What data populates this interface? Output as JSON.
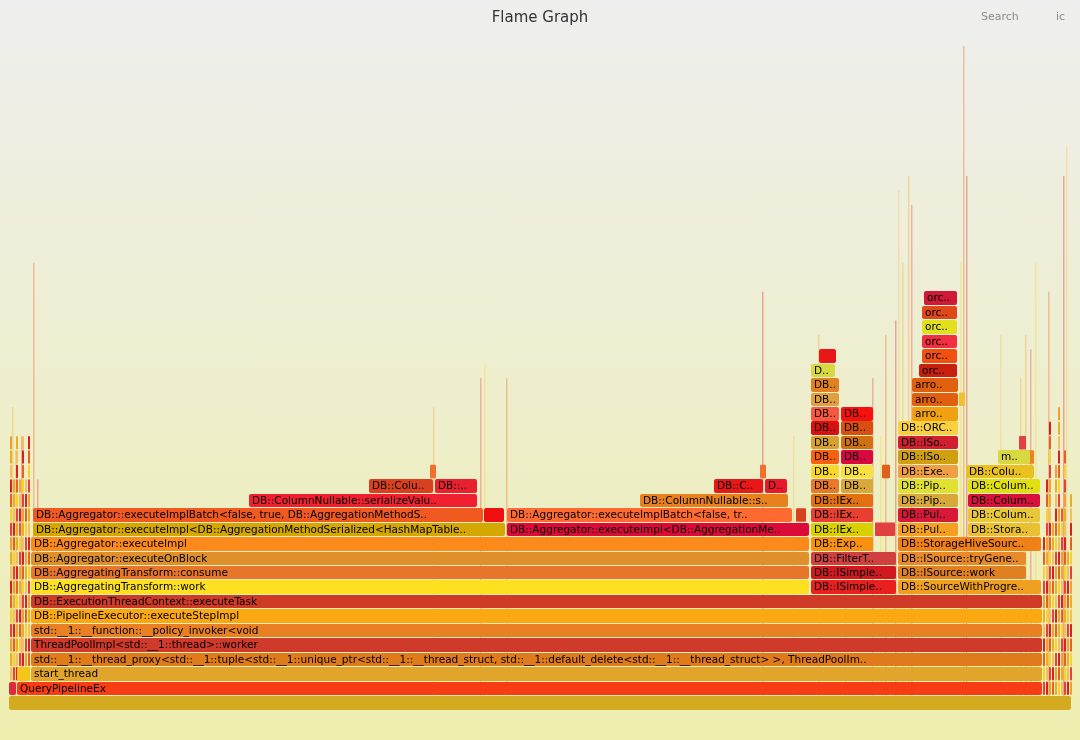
{
  "title": "Flame Graph",
  "search": {
    "label": "Search"
  },
  "toolbar_button": {
    "label": "ic"
  },
  "frames": [
    {
      "label": "orc..",
      "color": "#d01838"
    },
    {
      "label": "orc..",
      "color": "#e04818"
    },
    {
      "label": "orc..",
      "color": "#e0e020"
    },
    {
      "label": "orc..",
      "color": "#f03040"
    },
    {
      "color": "#e81818"
    },
    {
      "label": "orc..",
      "color": "#f05010"
    },
    {
      "label": "D..",
      "color": "#d8d840"
    },
    {
      "label": "orc..",
      "color": "#c82010"
    },
    {
      "label": "DB..",
      "color": "#e08020"
    },
    {
      "label": "arro..",
      "color": "#e06010"
    },
    {
      "label": "DB..",
      "color": "#e0a040"
    },
    {
      "label": "arro..",
      "color": "#e06010"
    },
    {
      "label": "DB..",
      "color": "#f85840"
    },
    {
      "label": "DB..",
      "color": "#f81010"
    },
    {
      "label": "arro..",
      "color": "#f0a010"
    },
    {
      "label": "DB..",
      "color": "#d81010"
    },
    {
      "label": "DB..",
      "color": "#d85010"
    },
    {
      "label": "DB::ORC..",
      "color": "#f8d040"
    },
    {
      "label": "DB..",
      "color": "#d8a030"
    },
    {
      "label": "DB..",
      "color": "#d07010"
    },
    {
      "label": "DB::ISo..",
      "color": "#d02030"
    },
    {
      "label": "DB..",
      "color": "#f86010"
    },
    {
      "label": "DB..",
      "color": "#d80840"
    },
    {
      "label": "DB::ISo..",
      "color": "#d0a010"
    },
    {
      "label": "m..",
      "color": "#d8d840"
    },
    {
      "label": "DB..",
      "color": "#f8d828"
    },
    {
      "label": "DB..",
      "color": "#f8e040"
    },
    {
      "label": "DB::Exe..",
      "color": "#f0a040"
    },
    {
      "label": "DB::Colu..",
      "color": "#e8c020"
    },
    {
      "label": "DB::Colu..",
      "color": "#d84020"
    },
    {
      "label": "DB::..",
      "color": "#e82030"
    },
    {
      "label": "DB::C..",
      "color": "#e81818"
    },
    {
      "label": "D..",
      "color": "#e81828"
    },
    {
      "label": "DB..",
      "color": "#e8782a"
    },
    {
      "label": "DB..",
      "color": "#d8a838"
    },
    {
      "label": "DB::Pip..",
      "color": "#e0e030"
    },
    {
      "label": "DB::Colum..",
      "color": "#e0e010"
    },
    {
      "label": "DB::ColumnNullable::serializeValu..",
      "color": "#f02030"
    },
    {
      "label": "DB::ColumnNullable::s..",
      "color": "#e8801c"
    },
    {
      "label": "DB::IEx..",
      "color": "#e07010"
    },
    {
      "label": "DB::Pip..",
      "color": "#d8a838"
    },
    {
      "label": "DB::Colum..",
      "color": "#d8103c"
    },
    {
      "label": "DB::Aggregator::executeImplBatch<false, true, DB::AggregationMethodS..",
      "color": "#f05a20"
    },
    {
      "color": "#f01010"
    },
    {
      "label": "DB::Aggregator::executeImplBatch<false, tr..",
      "color": "#ff6a30"
    },
    {
      "label": "DB::IEx..",
      "color": "#e84030"
    },
    {
      "label": "DB::Pul..",
      "color": "#d81838"
    },
    {
      "label": "DB::Colum..",
      "color": "#e8c838"
    },
    {
      "label": "DB::Aggregator::executeImpl<DB::AggregationMethodSerialized<HashMapTable..",
      "color": "#d4a800"
    },
    {
      "label": "DB::Aggregator::executeImpl<DB::AggregationMe..",
      "color": "#dc0a38"
    },
    {
      "label": "DB::IEx..",
      "color": "#d8d000"
    },
    {
      "label": "DB::Pul..",
      "color": "#f5a020"
    },
    {
      "label": "DB::Stora..",
      "color": "#e8c030"
    },
    {
      "label": "DB::Aggregator::executeImpl",
      "color": "#fb8a1a"
    },
    {
      "label": "DB::Exp..",
      "color": "#f89010"
    },
    {
      "label": "DB::StorageHiveSourc..",
      "color": "#f08018"
    },
    {
      "label": "DB::Aggregator::executeOnBlock",
      "color": "#e0902a"
    },
    {
      "label": "DB::FilterT..",
      "color": "#d04040"
    },
    {
      "label": "DB::ISource::tryGene..",
      "color": "#e88a2a"
    },
    {
      "label": "DB::AggregatingTransform::consume",
      "color": "#e8762a"
    },
    {
      "label": "DB::ISimple..",
      "color": "#d01820"
    },
    {
      "label": "DB::ISource::work",
      "color": "#e08020"
    },
    {
      "label": "DB::AggregatingTransform::work",
      "color": "#fde020"
    },
    {
      "label": "DB::ISimple..",
      "color": "#e82020"
    },
    {
      "label": "DB::SourceWithProgre..",
      "color": "#f0a020"
    },
    {
      "label": "DB::ExecutionThreadContext::executeTask",
      "color": "#cf3a26"
    },
    {
      "label": "DB::PipelineExecutor::executeStepImpl",
      "color": "#fca812"
    },
    {
      "label": "std::__1::__function::__policy_invoker<void",
      "color": "#e98024"
    },
    {
      "label": "ThreadPoolImpl<std::__1::thread>::worker",
      "color": "#d03a2a"
    },
    {
      "label": "std::__1::__thread_proxy<std::__1::tuple<std::__1::unique_ptr<std::__1::__thread_struct, std::__1::default_delete<std::__1::__thread_struct> >, ThreadPoolIm..",
      "color": "#e07b1c"
    },
    {
      "color": "#f5c518"
    },
    {
      "label": "start_thread",
      "color": "#e2a52c"
    },
    {
      "color": "#e0283c"
    },
    {
      "label": "QueryPipelineEx",
      "color": "#f83c14"
    },
    {
      "color": "#d4aa20"
    }
  ]
}
